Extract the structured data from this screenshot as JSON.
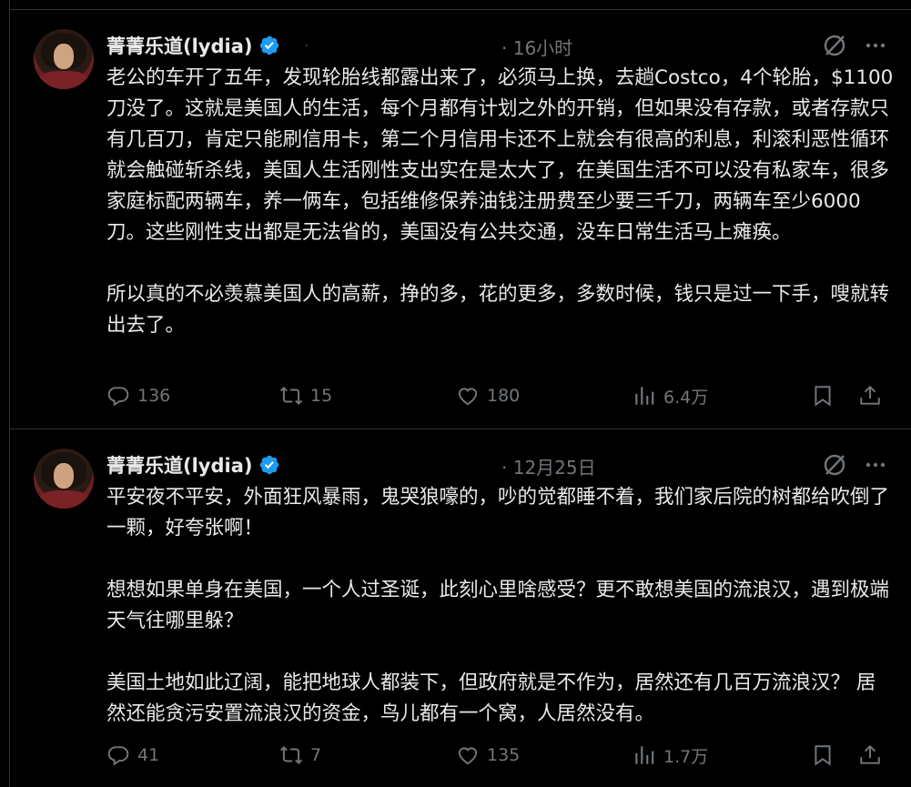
{
  "tweets": [
    {
      "author": "菁菁乐道(lydia)",
      "handle": "·",
      "time": "· 16小时",
      "text": "老公的车开了五年，发现轮胎线都露出来了，必须马上换，去趟Costco，4个轮胎，$1100刀没了。这就是美国人的生活，每个月都有计划之外的开销，但如果没有存款，或者存款只有几百刀，肯定只能刷信用卡，第二个月信用卡还不上就会有很高的利息，利滚利恶性循环就会触碰斩杀线，美国人生活刚性支出实在是太大了，在美国生活不可以没有私家车，很多家庭标配两辆车，养一俩车，包括维修保养油钱注册费至少要三千刀，两辆车至少6000刀。这些刚性支出都是无法省的，美国没有公共交通，没车日常生活马上瘫痪。\n\n所以真的不必羡慕美国人的高薪，挣的多，花的更多，多数时候，钱只是过一下手，嗖就转出去了。",
      "replies": "136",
      "reposts": "15",
      "likes": "180",
      "views": "6.4万"
    },
    {
      "author": "菁菁乐道(lydia)",
      "time": "· 12月25日",
      "text": "平安夜不平安，外面狂风暴雨，鬼哭狼嚎的，吵的觉都睡不着，我们家后院的树都给吹倒了一颗，好夸张啊！\n\n想想如果单身在美国，一个人过圣诞，此刻心里啥感受？更不敢想美国的流浪汉，遇到极端天气往哪里躲？\n\n美国土地如此辽阔，能把地球人都装下，但政府就是不作为，居然还有几百万流浪汉？ 居然还能贪污安置流浪汉的资金，鸟儿都有一个窝，人居然没有。",
      "replies": "41",
      "reposts": "7",
      "likes": "135",
      "views": "1.7万"
    }
  ],
  "colors": {
    "background": "#000000",
    "text": "#e7e9ea",
    "muted": "#71767b",
    "verified": "#1d9bf0",
    "border": "#2f3336"
  }
}
